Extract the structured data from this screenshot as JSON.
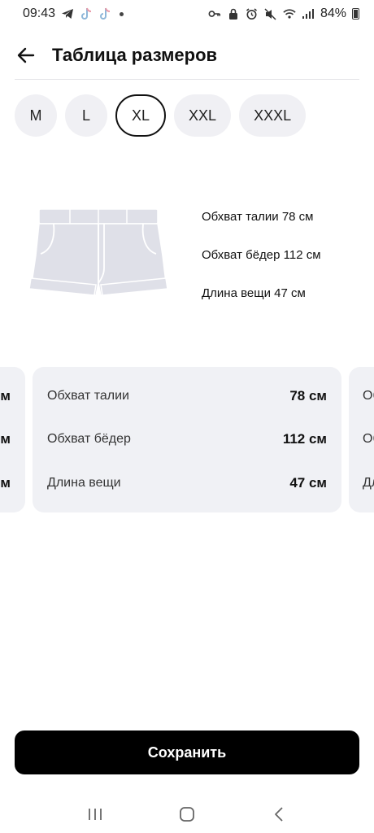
{
  "status_bar": {
    "time": "09:43",
    "battery": "84%",
    "battery_level": 0.84,
    "icons": [
      "telegram-icon",
      "tiktok-icon",
      "tiktok-icon",
      "notification-dot",
      "vpn-key-icon",
      "lock-icon",
      "alarm-icon",
      "mute-icon",
      "wifi-icon",
      "signal-icon",
      "battery-icon"
    ]
  },
  "header": {
    "title": "Таблица размеров",
    "back_icon": "arrow-left-icon"
  },
  "sizes": {
    "options": [
      "M",
      "L",
      "XL",
      "XXL",
      "XXXL"
    ],
    "selected": "XL"
  },
  "illustration": {
    "icon": "shorts-icon",
    "lines": [
      "Обхват талии 78 см",
      "Обхват бёдер 112 см",
      "Длина вещи 47 см"
    ]
  },
  "cards": {
    "prev": {
      "values": [
        "м",
        "м",
        "м"
      ]
    },
    "current": {
      "rows": [
        {
          "label": "Обхват талии",
          "value": "78 см"
        },
        {
          "label": "Обхват бёдер",
          "value": "112 см"
        },
        {
          "label": "Длина вещи",
          "value": "47 см"
        }
      ]
    },
    "next": {
      "labels": [
        "Об",
        "Об",
        "Дл"
      ]
    }
  },
  "save_button": {
    "label": "Сохранить"
  },
  "navbar": {
    "icons": [
      "recent-apps-icon",
      "home-icon",
      "back-icon"
    ]
  },
  "colors": {
    "accent": "#000000",
    "chip_bg": "#f0f0f4",
    "card_bg": "#f0f1f5",
    "illustration_fill": "#dfe0e8"
  }
}
